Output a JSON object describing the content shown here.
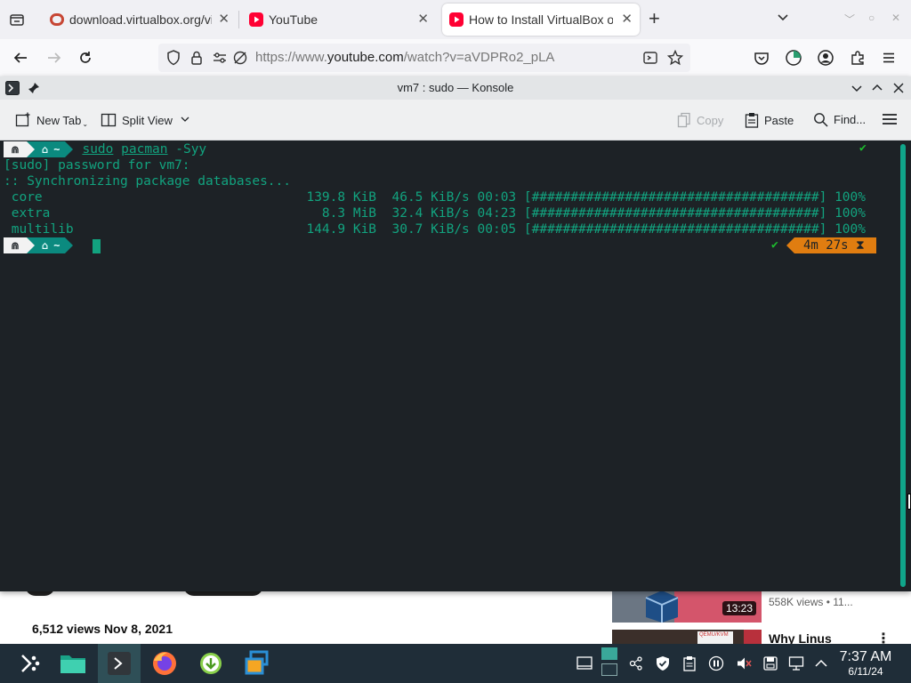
{
  "browser": {
    "tabs": [
      {
        "label": "download.virtualbox.org/vi",
        "favicon": "oracle-icon",
        "favicon_color": "#c74634",
        "active": false
      },
      {
        "label": "YouTube",
        "favicon": "youtube-icon",
        "favicon_color": "#ff0033",
        "active": false
      },
      {
        "label": "How to Install VirtualBox o",
        "favicon": "youtube-icon",
        "favicon_color": "#ff0033",
        "active": true
      }
    ],
    "url_prefix": "https://www.",
    "url_domain": "youtube.com",
    "url_path": "/watch?v=aVDPRo2_pLA"
  },
  "konsole": {
    "title": "vm7 : sudo — Konsole",
    "toolbar": {
      "new_tab": "New Tab",
      "split_view": "Split View",
      "copy": "Copy",
      "paste": "Paste",
      "find": "Find..."
    }
  },
  "terminal": {
    "prompt_os_glyph": "⋒",
    "prompt_dir": "~",
    "command_sudo": "sudo",
    "command_pacman": "pacman",
    "command_args": " -Syy",
    "lines": [
      "[sudo] password for vm7:",
      ":: Synchronizing package databases...",
      " core                                  139.8 KiB  46.5 KiB/s 00:03 [#####################################] 100%",
      " extra                                   8.3 MiB  32.4 KiB/s 04:23 [#####################################] 100%",
      " multilib                              144.9 KiB  30.7 KiB/s 00:05 [#####################################] 100%"
    ],
    "status_ok": "✔",
    "elapsed": "4m 27s",
    "elapsed_glyph": "⧗",
    "accent_green": "#12a37f",
    "timer_color": "#e07d10"
  },
  "youtube": {
    "views_date": "6,512 views  Nov 8, 2021",
    "side_duration": "13:23",
    "side_meta": "558K views  • 11...",
    "side_title": "Why Linus",
    "side_badge": "QEMU/KVM"
  },
  "taskbar": {
    "apps": [
      "app-launcher",
      "file-manager",
      "konsole",
      "firefox",
      "downloader",
      "virtualbox"
    ],
    "clock_time": "7:37 AM",
    "clock_date": "6/11/24"
  }
}
